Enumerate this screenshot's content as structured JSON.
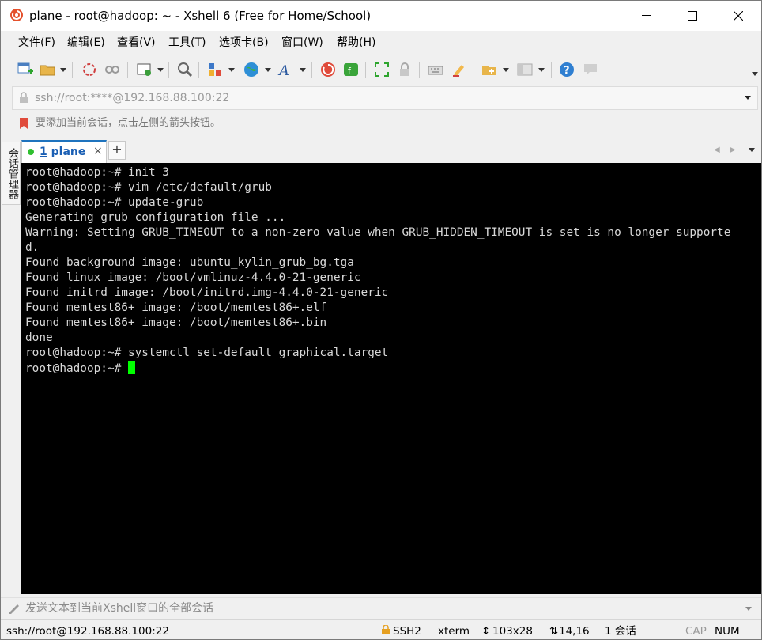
{
  "window": {
    "title": "plane - root@hadoop: ~ - Xshell 6 (Free for Home/School)"
  },
  "menu": [
    {
      "label": "文件(F)"
    },
    {
      "label": "编辑(E)"
    },
    {
      "label": "查看(V)"
    },
    {
      "label": "工具(T)"
    },
    {
      "label": "选项卡(B)"
    },
    {
      "label": "窗口(W)"
    },
    {
      "label": "帮助(H)"
    }
  ],
  "address": {
    "value": "ssh://root:****@192.168.88.100:22"
  },
  "hint": {
    "text": "要添加当前会话，点击左侧的箭头按钮。"
  },
  "session_manager": {
    "label": "会话管理器"
  },
  "tabs": [
    {
      "number": "1",
      "name": "plane",
      "close": "×",
      "status_color": "#2fbf2f"
    }
  ],
  "tab_add": "+",
  "terminal": {
    "cursor_color": "#00ff00",
    "lines": [
      "root@hadoop:~# init 3",
      "root@hadoop:~# vim /etc/default/grub",
      "root@hadoop:~# update-grub",
      "Generating grub configuration file ...",
      "Warning: Setting GRUB_TIMEOUT to a non-zero value when GRUB_HIDDEN_TIMEOUT is set is no longer supporte",
      "d.",
      "Found background image: ubuntu_kylin_grub_bg.tga",
      "Found linux image: /boot/vmlinuz-4.4.0-21-generic",
      "Found initrd image: /boot/initrd.img-4.4.0-21-generic",
      "Found memtest86+ image: /boot/memtest86+.elf",
      "Found memtest86+ image: /boot/memtest86+.bin",
      "done",
      "root@hadoop:~# systemctl set-default graphical.target",
      "root@hadoop:~# "
    ]
  },
  "sendbar": {
    "placeholder": "发送文本到当前Xshell窗口的全部会话"
  },
  "status": {
    "connection": "ssh://root@192.168.88.100:22",
    "protocol": "SSH2",
    "terminal_type": "xterm",
    "size": "103x28",
    "cursor_pos": "14,16",
    "sessions": "1 会话",
    "cap": "CAP",
    "num": "NUM"
  },
  "colors": {
    "accent": "#1e73be",
    "terminal_bg": "#000000",
    "terminal_fg": "#d8d8d8"
  }
}
